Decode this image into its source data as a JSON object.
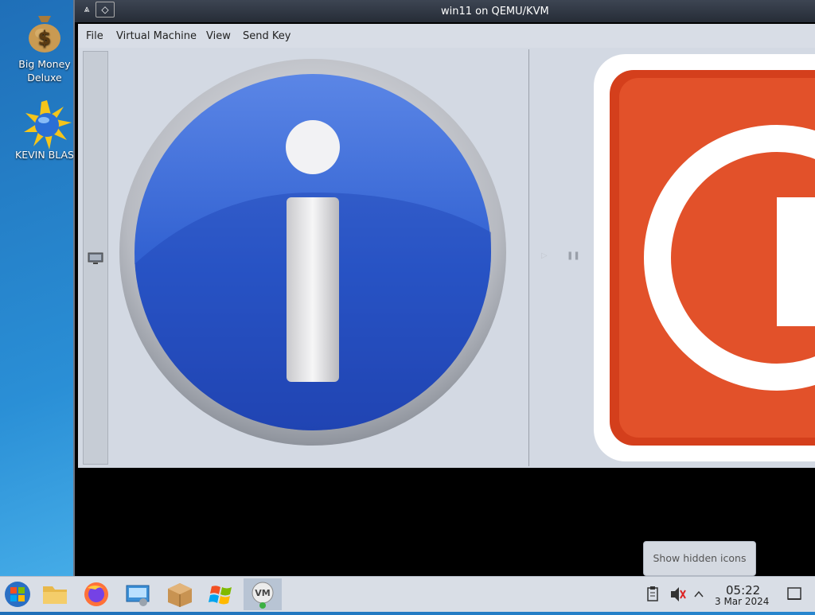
{
  "desktop": {
    "icons": [
      {
        "label_line1": "Big Money",
        "label_line2": "Deluxe",
        "icon": "money-bag-icon"
      },
      {
        "label_line1": "KEVIN BLAS",
        "icon": "sun-globe-icon"
      }
    ]
  },
  "window": {
    "title": "win11 on QEMU/KVM",
    "menu": [
      "File",
      "Virtual Machine",
      "View",
      "Send Key"
    ]
  },
  "tooltip": {
    "text": "Show hidden icons"
  },
  "taskbar": {
    "apps": [
      {
        "icon": "start-orb-icon"
      },
      {
        "icon": "file-manager-icon"
      },
      {
        "icon": "firefox-icon"
      },
      {
        "icon": "remote-desktop-icon"
      },
      {
        "icon": "package-icon"
      },
      {
        "icon": "windows-logo-icon"
      },
      {
        "icon": "virt-manager-icon",
        "active": true
      }
    ],
    "clock": {
      "time": "05:22",
      "date": "3 Mar 2024"
    }
  },
  "colors": {
    "info_blue": "#2f5fd0",
    "error_red": "#e2512a",
    "taskbar_bg": "#d9dee6"
  }
}
